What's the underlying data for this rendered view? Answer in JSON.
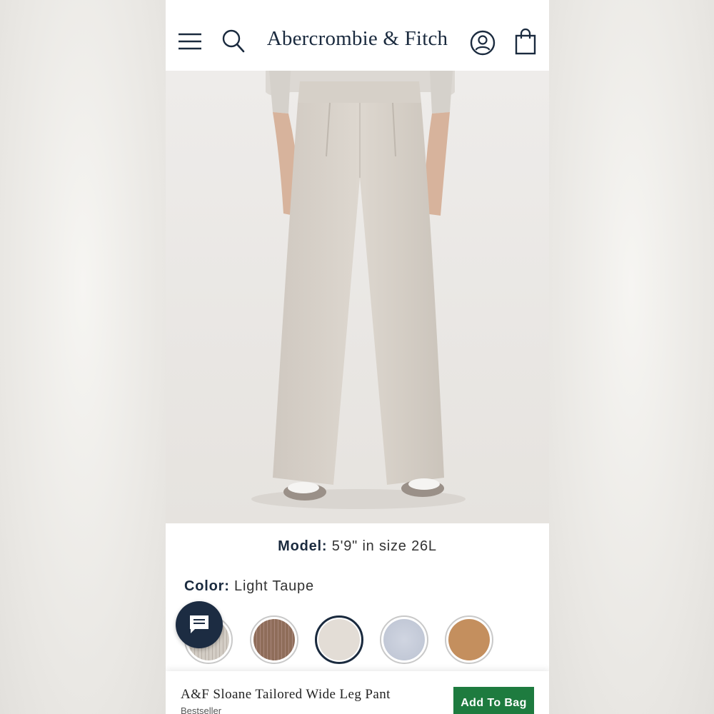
{
  "header": {
    "logo_text": "Abercrombie & Fitch",
    "menu_icon": "hamburger-menu-icon",
    "search_icon": "search-icon",
    "account_icon": "account-icon",
    "bag_icon": "shopping-bag-icon"
  },
  "product_image": {
    "description_alt": "Light Taupe wide leg pant on model"
  },
  "model_info": {
    "label": "Model:",
    "value": "5'9\" in size 26L"
  },
  "color": {
    "label": "Color:",
    "selected": "Light Taupe",
    "swatches": [
      {
        "name": "pinstripe-gray",
        "color": "#cfc8c0"
      },
      {
        "name": "brown-pinstripe",
        "color": "#8f6d5a"
      },
      {
        "name": "light-taupe",
        "color": "#e3ddd6",
        "selected": true
      },
      {
        "name": "light-blue-heather",
        "color": "#c4cad8"
      },
      {
        "name": "camel",
        "color": "#c48f5e"
      }
    ]
  },
  "chat": {
    "icon": "chat-icon"
  },
  "sticky_bar": {
    "product_name": "A&F Sloane Tailored Wide Leg Pant",
    "badge": "Bestseller",
    "add_to_bag": "Add To Bag"
  },
  "colors": {
    "brand_navy": "#1a2a3e",
    "add_button_green": "#1e7b3f"
  }
}
